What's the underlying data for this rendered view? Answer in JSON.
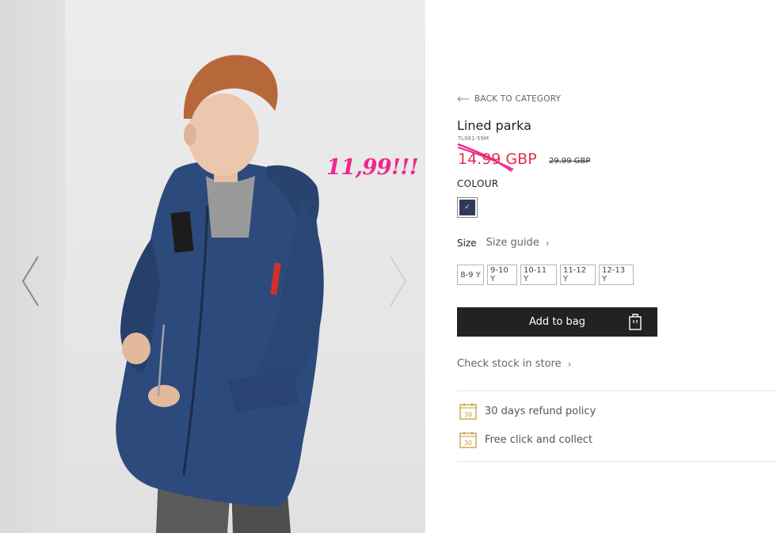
{
  "gallery": {
    "jacket_badge_lines": [
      "STAY /",
      "D:YSH",
      "—OJB"
    ],
    "prev_icon": "chevron-left-icon",
    "next_icon": "chevron-right-icon"
  },
  "overlay": {
    "sticker_text": "11,99!!!",
    "accent": "#f0268f"
  },
  "product": {
    "back_label": "BACK TO CATEGORY",
    "title": "Lined parka",
    "sku": "TL981-59M",
    "price": "14.99 GBP",
    "old_price": "29.99 GBP",
    "price_color": "#e0304f",
    "colour_label": "COLOUR",
    "selected_colour": "#2e3a58",
    "size_label": "Size",
    "size_guide_label": "Size guide",
    "sizes": [
      "8-9 Y",
      "9-10 Y",
      "10-11 Y",
      "11-12 Y",
      "12-13 Y"
    ],
    "add_to_bag_label": "Add to bag",
    "check_stock_label": "Check stock in store",
    "refund_label": "30 days refund policy",
    "collect_label": "Free click and collect",
    "calendar_icon_text": "30"
  }
}
